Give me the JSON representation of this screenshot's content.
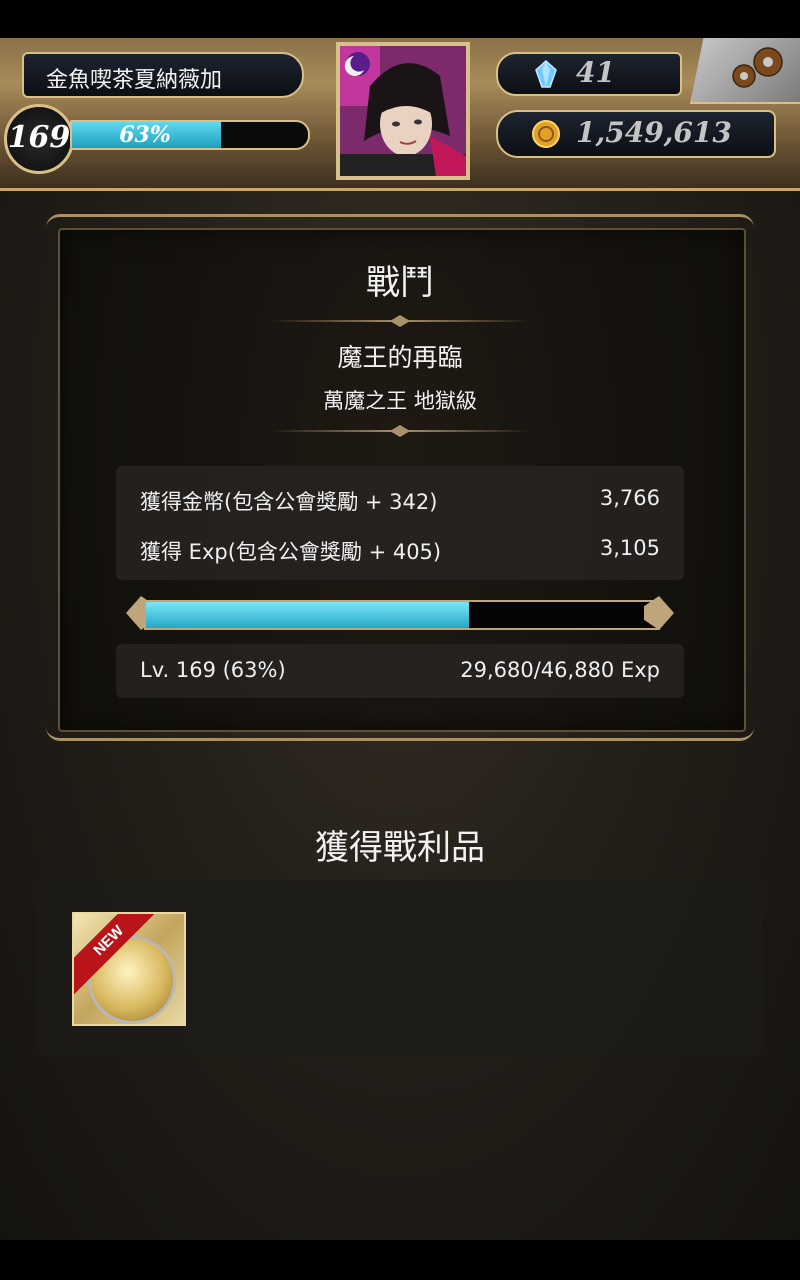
{
  "player": {
    "name": "金魚喫茶夏納薇加",
    "level": "169",
    "xp_percent_label": "63%",
    "xp_fraction": 0.63
  },
  "currency": {
    "gems": "41",
    "gold": "1,549,613"
  },
  "battle": {
    "heading": "戰鬥",
    "quest_title": "魔王的再臨",
    "quest_subtitle": "萬魔之王 地獄級",
    "gold_label": "獲得金幣(包含公會獎勵 + 342)",
    "gold_value": "3,766",
    "exp_label": "獲得 Exp(包含公會獎勵 + 405)",
    "exp_value": "3,105",
    "level_status": "Lv. 169 (63%)",
    "exp_progress": "29,680/46,880 Exp",
    "exp_fraction": 0.63
  },
  "loot": {
    "heading": "獲得戰利品",
    "items": [
      {
        "badge": "NEW",
        "icon": "gold-coin-card-icon"
      }
    ]
  },
  "colors": {
    "xp_fill": "#1b9fc0",
    "frame_gold": "#d8c08a",
    "new_badge": "#b8141a"
  }
}
